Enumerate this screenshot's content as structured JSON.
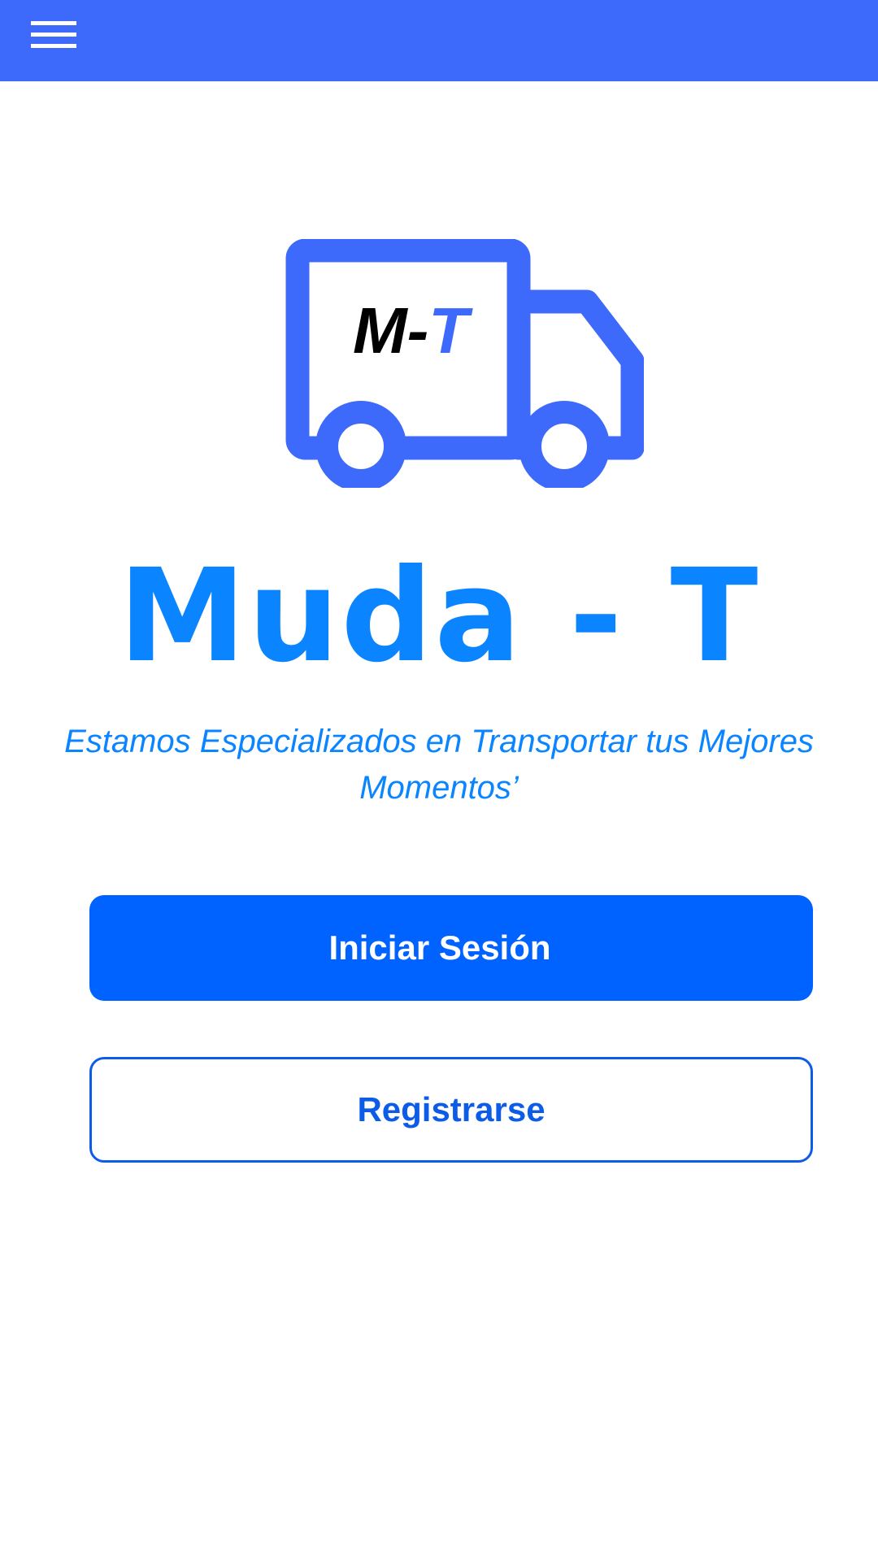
{
  "header": {
    "menu_icon": "hamburger-menu-icon"
  },
  "logo": {
    "icon": "truck-icon",
    "text_left": "M-",
    "text_right": "T"
  },
  "title": "Muda - T",
  "tagline": "Estamos Especializados en Transportar tus  Mejores Momentos’",
  "buttons": {
    "login_label": "Iniciar Sesión",
    "register_label": "Registrarse"
  },
  "colors": {
    "header_bg": "#3d6afa",
    "accent": "#0a84ff",
    "primary_button": "#0062ff",
    "truck": "#3d6afa"
  }
}
